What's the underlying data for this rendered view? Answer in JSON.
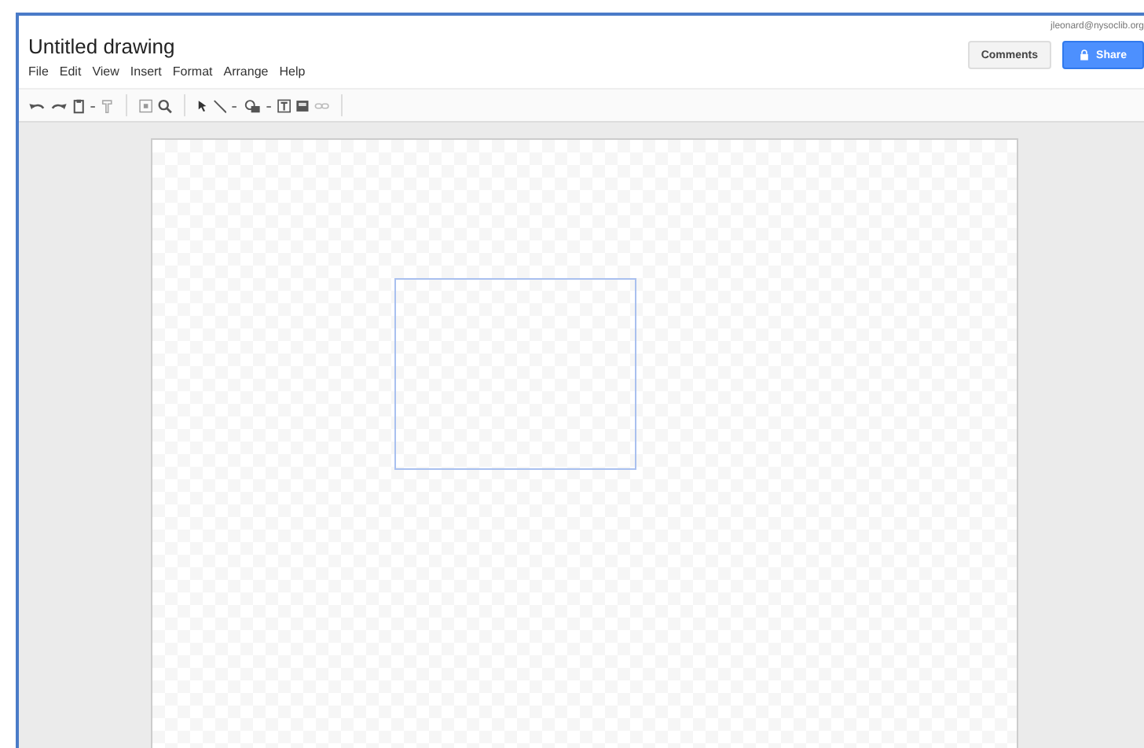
{
  "document": {
    "title": "Untitled drawing"
  },
  "menu": [
    "File",
    "Edit",
    "View",
    "Insert",
    "Format",
    "Arrange",
    "Help"
  ],
  "account": {
    "email": "jleonard@nysoclib.org"
  },
  "buttons": [
    {
      "kind": "plain",
      "label": "Comments"
    },
    {
      "kind": "share",
      "label": "Share"
    }
  ],
  "toolbar": [
    {
      "kind": "undo"
    },
    {
      "kind": "redo"
    },
    {
      "kind": "paint"
    },
    {
      "kind": "caret"
    },
    {
      "kind": "format"
    },
    {
      "kind": "sep"
    },
    {
      "kind": "fit"
    },
    {
      "kind": "zoom"
    },
    {
      "kind": "sep"
    },
    {
      "kind": "select"
    },
    {
      "kind": "line"
    },
    {
      "kind": "caret"
    },
    {
      "kind": "shape"
    },
    {
      "kind": "caret"
    },
    {
      "kind": "textbox"
    },
    {
      "kind": "image"
    },
    {
      "kind": "link"
    },
    {
      "kind": "sep"
    }
  ],
  "canvas": {
    "shapes": [
      {
        "kind": "rectangle"
      }
    ]
  }
}
